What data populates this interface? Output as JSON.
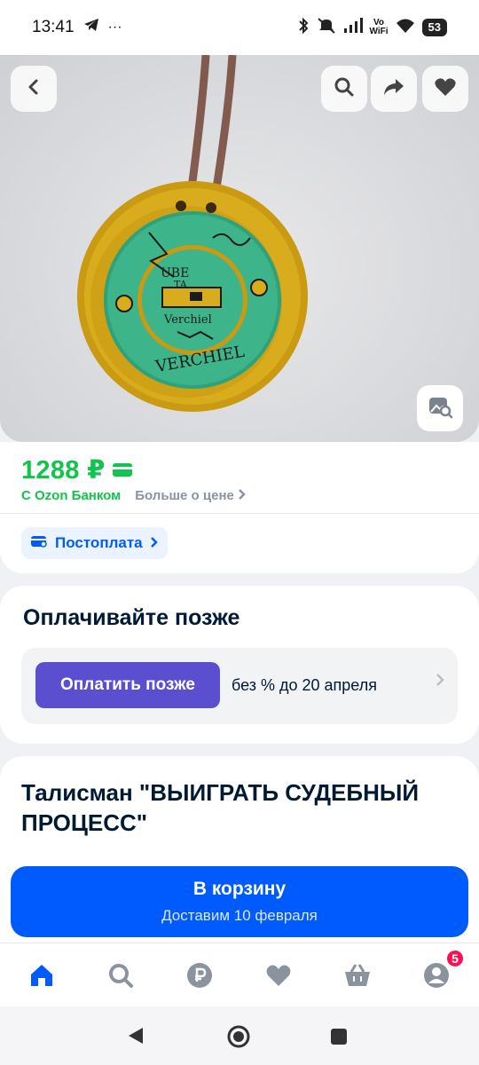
{
  "status_bar": {
    "time": "13:41",
    "wifi_label_top": "Vo",
    "wifi_label_bottom": "WiFi",
    "battery": "53",
    "more": "···"
  },
  "hero": {
    "icons": [
      "back-icon",
      "search-icon",
      "share-icon",
      "heart-icon",
      "photo-search-icon"
    ],
    "pendant_text_top": "UBE",
    "pendant_text_mid": "TA",
    "pendant_text_name": "Verchiel",
    "pendant_text_arc": "VERCHIEL"
  },
  "price": {
    "value": "1288 ₽",
    "bank_label": "С Ozon Банком",
    "more_label": "Больше о цене",
    "postpay_label": "Постоплата",
    "color": "#10c44c"
  },
  "pay_later": {
    "title": "Оплачивайте позже",
    "button_label": "Оплатить позже",
    "note": "без % до 20 апреля",
    "button_color": "#5b4fcf"
  },
  "product": {
    "title": "Талисман \"ВЫИГРАТЬ СУДЕБНЫЙ ПРОЦЕСС\""
  },
  "cart": {
    "label": "В корзину",
    "delivery": "Доставим 10 февраля",
    "color": "#005bff"
  },
  "tabbar": {
    "items": [
      "home-icon",
      "search-icon",
      "ruble-icon",
      "favorites-icon",
      "basket-icon",
      "profile-icon"
    ],
    "profile_badge": "5",
    "active_color": "#005bff"
  }
}
